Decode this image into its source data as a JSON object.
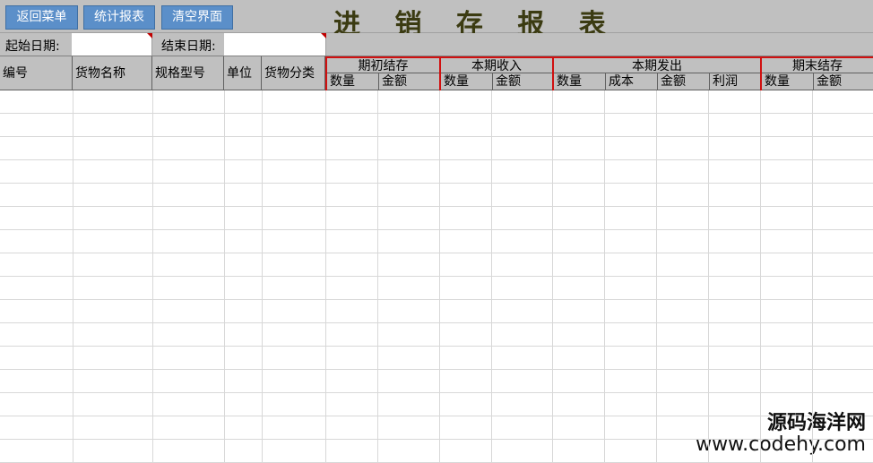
{
  "toolbar": {
    "back_label": "返回菜单",
    "stats_label": "统计报表",
    "clear_label": "清空界面",
    "title": "进 销 存 报 表"
  },
  "dates": {
    "start_label": "起始日期:",
    "start_value": "",
    "end_label": "结束日期:",
    "end_value": ""
  },
  "columns": {
    "id": "编号",
    "name": "货物名称",
    "spec": "规格型号",
    "unit": "单位",
    "category": "货物分类"
  },
  "groups": {
    "opening": {
      "title": "期初结存",
      "qty": "数量",
      "amount": "金额"
    },
    "income": {
      "title": "本期收入",
      "qty": "数量",
      "amount": "金额"
    },
    "outgoing": {
      "title": "本期发出",
      "qty": "数量",
      "cost": "成本",
      "amount": "金额",
      "profit": "利润"
    },
    "closing": {
      "title": "期末结存",
      "qty": "数量",
      "amount": "金额"
    }
  },
  "watermark": {
    "name": "源码海洋网",
    "url": "www.codehy.com"
  },
  "colors": {
    "button_bg": "#5b8fc9",
    "group_border": "#d01010",
    "toolbar_bg": "#c0c0c0"
  }
}
